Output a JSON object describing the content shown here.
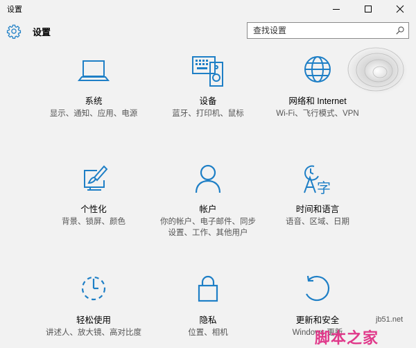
{
  "window": {
    "title": "设置"
  },
  "header": {
    "title": "设置"
  },
  "search": {
    "placeholder": "查找设置"
  },
  "tiles": [
    {
      "name": "系统",
      "desc": "显示、通知、应用、电源"
    },
    {
      "name": "设备",
      "desc": "蓝牙、打印机、鼠标"
    },
    {
      "name": "网络和 Internet",
      "desc": "Wi-Fi、飞行模式、VPN"
    },
    {
      "name": "个性化",
      "desc": "背景、锁屏、颜色"
    },
    {
      "name": "帐户",
      "desc": "你的帐户、电子邮件、同步设置、工作、其他用户"
    },
    {
      "name": "时间和语言",
      "desc": "语音、区域、日期"
    },
    {
      "name": "轻松使用",
      "desc": "讲述人、放大镜、高对比度"
    },
    {
      "name": "隐私",
      "desc": "位置、相机"
    },
    {
      "name": "更新和安全",
      "desc": "Windows 更新"
    }
  ],
  "colors": {
    "accent": "#1e7fc6",
    "background": "#f2f2f2",
    "watermark_pink": "#e0388a"
  },
  "watermark": {
    "site": "jb51.net",
    "brand": "脚本之家"
  }
}
